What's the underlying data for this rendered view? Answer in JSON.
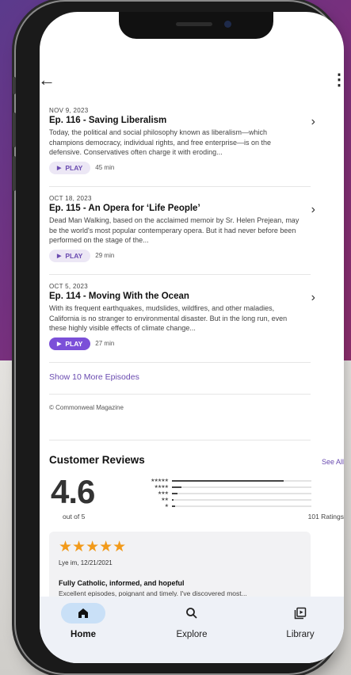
{
  "header": {
    "back_icon": "arrow-left-icon",
    "more_icon": "more-vertical-icon"
  },
  "episodes": [
    {
      "date": "NOV 9, 2023",
      "title": "Ep. 116 - Saving Liberalism",
      "description": "Today, the political and social philosophy known as liberalism—which champions democracy, individual rights, and free enterprise—is on the defensive. Conservatives often charge it with eroding...",
      "play_label": "PLAY",
      "duration": "45 min",
      "playing": false
    },
    {
      "date": "OCT 18, 2023",
      "title": "Ep. 115 - An Opera for ‘Life People’",
      "description": "Dead Man Walking, based on the acclaimed memoir by Sr. Helen Prejean, may be the world's most popular contemperary opera. But it had never before been performed on the stage of the...",
      "play_label": "PLAY",
      "duration": "29 min",
      "playing": false
    },
    {
      "date": "OCT 5, 2023",
      "title": "Ep. 114 - Moving With the Ocean",
      "description": "With its frequent earthquakes, mudslides, wildfires, and other maladies, California is no stranger to environmental disaster. But in the long run, even these highly visible effects of climate change...",
      "play_label": "PLAY",
      "duration": "27 min",
      "playing": true
    }
  ],
  "show_more_label": "Show 10 More Episodes",
  "copyright": "© Commonweal Magazine",
  "reviews": {
    "title": "Customer Reviews",
    "see_all": "See All",
    "rating": "4.6",
    "out_of": "out of 5",
    "ratings_count": "101 Ratings",
    "distribution": [
      {
        "stars": "★★★★★",
        "fraction": 0.8
      },
      {
        "stars": "★★★★",
        "fraction": 0.07
      },
      {
        "stars": "★★★",
        "fraction": 0.04
      },
      {
        "stars": "★★",
        "fraction": 0.01
      },
      {
        "stars": "★",
        "fraction": 0.02
      }
    ],
    "card": {
      "stars": "★★★★★",
      "meta": "Lye im, 12/21/2021",
      "headline": "Fully Catholic, informed, and hopeful",
      "body": "Excellent episodes, poignant and timely. I've discovered most..."
    }
  },
  "tabs": [
    {
      "label": "Home",
      "icon": "home-icon",
      "active": true
    },
    {
      "label": "Explore",
      "icon": "search-icon",
      "active": false
    },
    {
      "label": "Library",
      "icon": "library-icon",
      "active": false
    }
  ],
  "colors": {
    "accent": "#7b4fd8",
    "accent_text": "#6a4bb0",
    "star": "#f29a1a",
    "tab_active": "#c9e0f7"
  }
}
